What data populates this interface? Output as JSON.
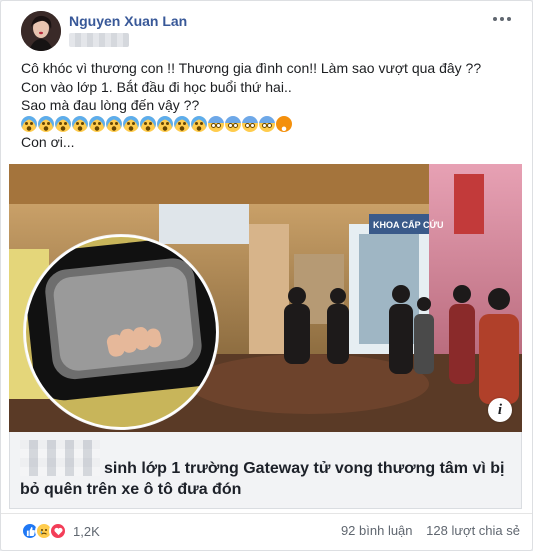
{
  "post": {
    "author": "Nguyen Xuan Lan",
    "lines": [
      "Cô khóc vì thương con !! Thương gia đình con!! Làm sao vượt qua đây ??",
      "Con vào lớp 1. Bắt đầu đi học buổi thứ hai..",
      "Sao mà đau lòng đến vậy ??",
      "Con ơi..."
    ],
    "emojis": [
      "crying-face",
      "crying-face",
      "crying-face",
      "crying-face",
      "crying-face",
      "crying-face",
      "crying-face",
      "crying-face",
      "crying-face",
      "crying-face",
      "crying-face",
      "fearful-face",
      "fearful-face",
      "fearful-face",
      "fearful-face",
      "angry-face"
    ]
  },
  "link": {
    "sign_text": "KHOA CẤP CỨU",
    "title_line1": "sinh lớp 1 trường Gateway tử vong thương tâm vì bị",
    "title_line2": "bỏ quên trên xe ô tô đưa đón",
    "info_glyph": "i"
  },
  "footer": {
    "reaction_count": "1,2K",
    "comments": "92 bình luận",
    "shares": "128 lượt chia sẻ",
    "reactions": [
      "like",
      "sad",
      "love"
    ]
  },
  "colors": {
    "author": "#385898",
    "like": "#2078f4",
    "love": "#f33e58"
  }
}
